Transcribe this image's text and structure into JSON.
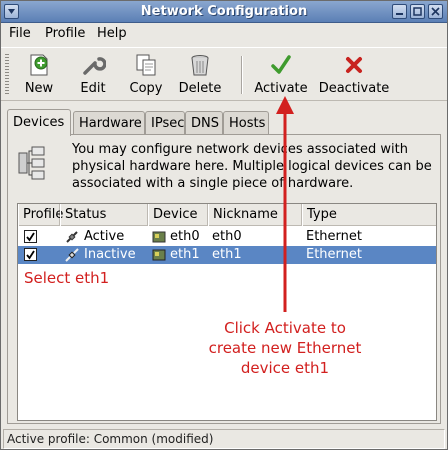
{
  "window": {
    "title": "Network Configuration"
  },
  "menu": {
    "file": "File",
    "profile": "Profile",
    "help": "Help"
  },
  "toolbar": {
    "new": "New",
    "edit": "Edit",
    "copy": "Copy",
    "delete": "Delete",
    "activate": "Activate",
    "deactivate": "Deactivate"
  },
  "tabs": [
    "Devices",
    "Hardware",
    "IPsec",
    "DNS",
    "Hosts"
  ],
  "info": "You may configure network devices associated with physical hardware here.  Multiple logical devices can be associated with a single piece of hardware.",
  "list": {
    "headers": [
      "Profile",
      "Status",
      "Device",
      "Nickname",
      "Type"
    ],
    "rows": [
      {
        "profile_checked": true,
        "status": "Active",
        "device": "eth0",
        "nickname": "eth0",
        "type": "Ethernet",
        "selected": false
      },
      {
        "profile_checked": true,
        "status": "Inactive",
        "device": "eth1",
        "nickname": "eth1",
        "type": "Ethernet",
        "selected": true
      }
    ]
  },
  "annotations": {
    "select": "Select eth1",
    "activate_line1": "Click Activate to",
    "activate_line2": "create new Ethernet",
    "activate_line3": "device eth1"
  },
  "status": "Active profile: Common (modified)",
  "colors": {
    "selection": "#5a86c4",
    "annotation": "#d2201f",
    "titlebar": "#5b7fb5"
  }
}
